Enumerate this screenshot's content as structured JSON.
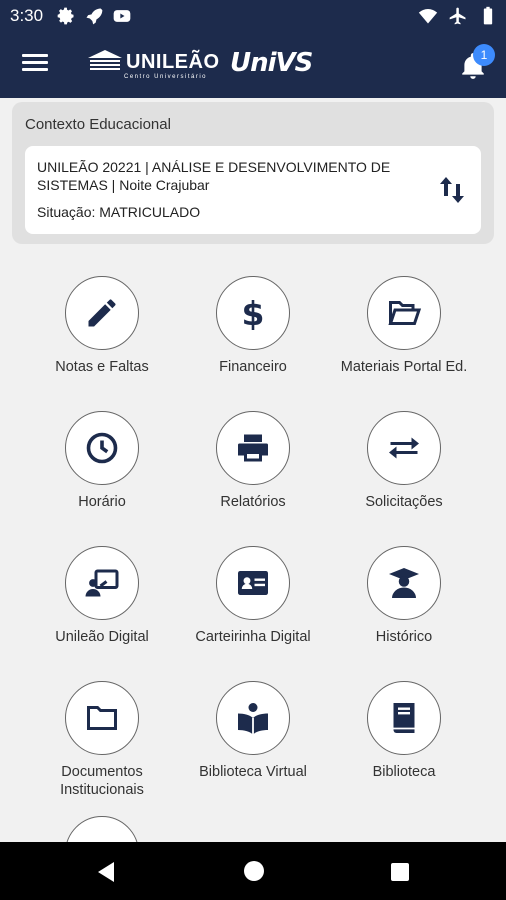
{
  "status_bar": {
    "time": "3:30"
  },
  "app_bar": {
    "logo_primary": "UNILEÃO",
    "logo_primary_sub": "Centro Universitário",
    "logo_secondary": "UniVS",
    "notification_count": "1"
  },
  "context": {
    "title": "Contexto Educacional",
    "course": "UNILEÃO 20221 | ANÁLISE E DESENVOLVIMENTO DE SISTEMAS | Noite Crajubar",
    "situation": "Situação: MATRICULADO"
  },
  "menu": {
    "items": [
      {
        "label": "Notas e Faltas",
        "icon": "pencil-icon"
      },
      {
        "label": "Financeiro",
        "icon": "dollar-icon"
      },
      {
        "label": "Materiais Portal Ed.",
        "icon": "folder-open-icon"
      },
      {
        "label": "Horário",
        "icon": "clock-icon"
      },
      {
        "label": "Relatórios",
        "icon": "printer-icon"
      },
      {
        "label": "Solicitações",
        "icon": "exchange-icon"
      },
      {
        "label": "Unileão Digital",
        "icon": "presentation-icon"
      },
      {
        "label": "Carteirinha Digital",
        "icon": "id-card-icon"
      },
      {
        "label": "Histórico",
        "icon": "graduate-icon"
      },
      {
        "label": "Documentos Institucionais",
        "icon": "folder-icon"
      },
      {
        "label": "Biblioteca Virtual",
        "icon": "reading-icon"
      },
      {
        "label": "Biblioteca",
        "icon": "book-icon"
      }
    ]
  },
  "colors": {
    "primary": "#1d2b4c",
    "badge": "#3d8bfd",
    "background": "#f1f1f1"
  }
}
